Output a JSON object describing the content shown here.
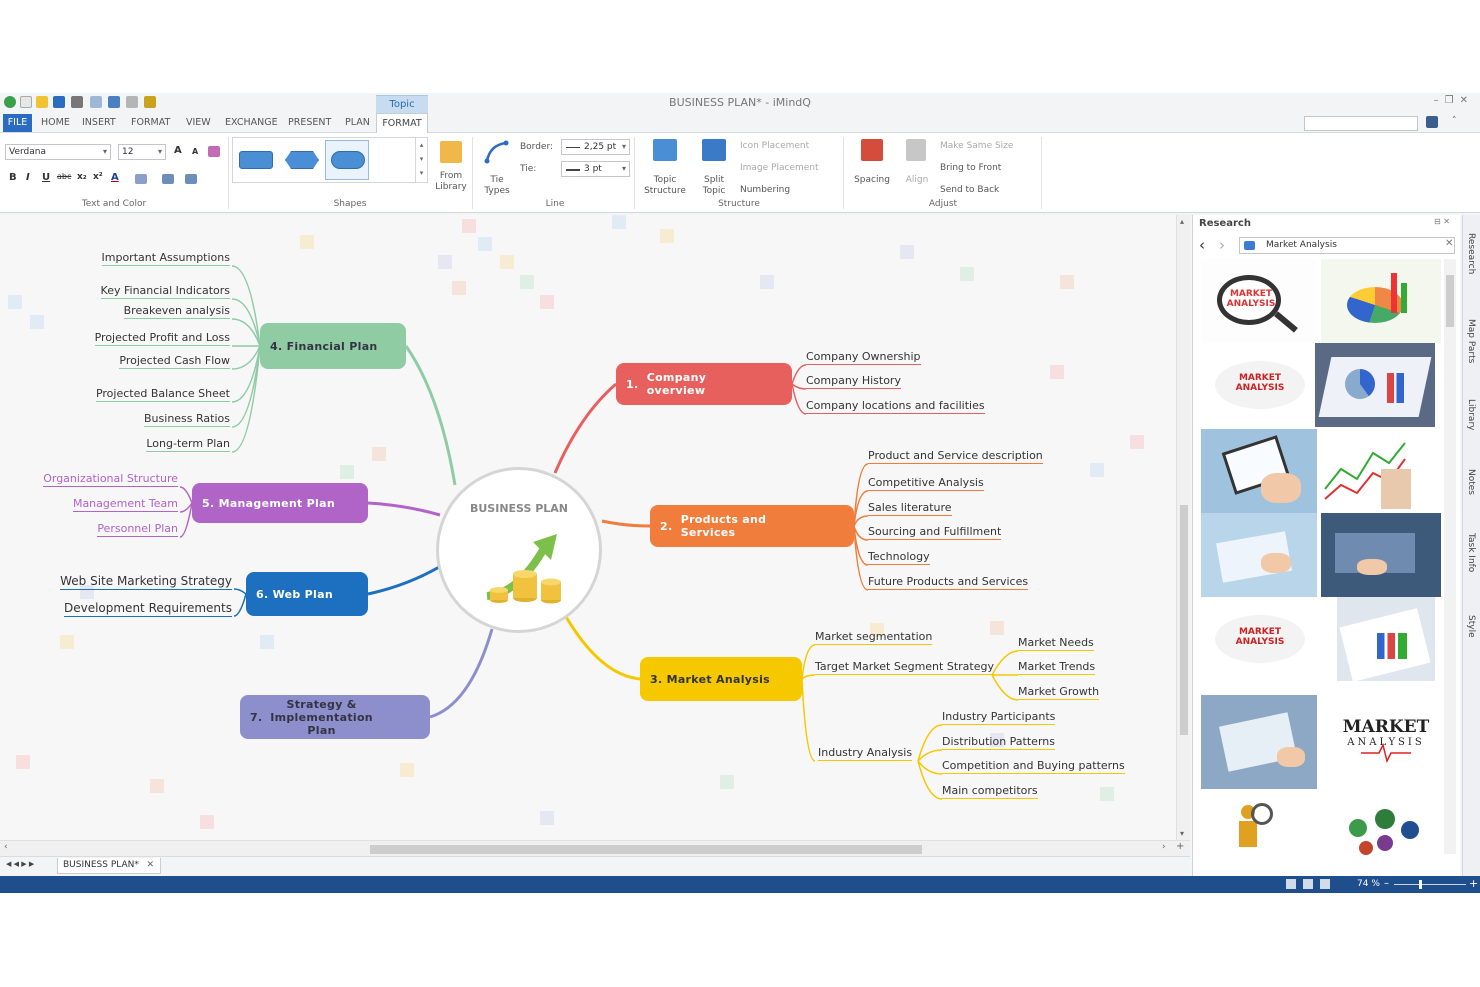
{
  "window": {
    "title": "BUSINESS PLAN* - iMindQ",
    "context_tab": "Topic",
    "min_btn": "–",
    "restore_btn": "❐",
    "close_btn": "✕"
  },
  "menu": {
    "file": "FILE",
    "items": [
      "HOME",
      "INSERT",
      "FORMAT",
      "VIEW",
      "EXCHANGE",
      "PRESENT",
      "PLAN"
    ],
    "active": "FORMAT"
  },
  "ribbon": {
    "font_name": "Verdana",
    "font_size": "12",
    "format_buttons": [
      "B",
      "I",
      "U",
      "abc",
      "x₂",
      "x²",
      "A"
    ],
    "group_text_color": "Text and Color",
    "group_shapes": "Shapes",
    "from_library": "From Library",
    "tie_types": "Tie Types",
    "border_label": "Border:",
    "border_value": "2,25 pt",
    "tie_label": "Tie:",
    "tie_value": "3 pt",
    "group_line": "Line",
    "topic_structure": "Topic Structure",
    "split_topic": "Split Topic",
    "icon_placement": "Icon Placement",
    "image_placement": "Image Placement",
    "numbering": "Numbering",
    "group_structure": "Structure",
    "spacing": "Spacing",
    "align": "Align",
    "make_same_size": "Make Same Size",
    "bring_to_front": "Bring to Front",
    "send_to_back": "Send to Back",
    "group_adjust": "Adjust"
  },
  "mindmap": {
    "center": "BUSINESS PLAN",
    "topics": {
      "company": {
        "num": "1.",
        "label": "Company overview",
        "color": "#e8605e"
      },
      "products": {
        "num": "2.",
        "label": "Products and Services",
        "color": "#f07d3c"
      },
      "market": {
        "num": "3.",
        "label": "Market Analysis",
        "color": "#f5c800"
      },
      "financial": {
        "num": "4.",
        "label": "Financial Plan",
        "color": "#8fcca4"
      },
      "management": {
        "num": "5.",
        "label": "Management Plan",
        "color": "#b064c8"
      },
      "web": {
        "num": "6.",
        "label": "Web Plan",
        "color": "#1d6fbf"
      },
      "strategy": {
        "num": "7.",
        "label": "Strategy & Implementation Plan",
        "color": "#8d8fcc"
      }
    },
    "company_subs": [
      "Company Ownership",
      "Company History",
      "Company locations and facilities"
    ],
    "products_subs": [
      "Product and Service description",
      "Competitive Analysis",
      "Sales literature",
      "Sourcing and Fulfillment",
      "Technology",
      "Future Products and Services"
    ],
    "market_subs": [
      "Market segmentation",
      "Target Market Segment Strategy",
      "Industry Analysis"
    ],
    "target_subs": [
      "Market Needs",
      "Market Trends",
      "Market Growth"
    ],
    "industry_subs": [
      "Industry Participants",
      "Distribution Patterns",
      "Competition and Buying patterns",
      "Main competitors"
    ],
    "financial_subs": [
      "Important Assumptions",
      "Key Financial Indicators",
      "Breakeven analysis",
      "Projected Profit and Loss",
      "Projected Cash Flow",
      "Projected Balance Sheet",
      "Business Ratios",
      "Long-term Plan"
    ],
    "management_subs": [
      "Organizational Structure",
      "Management Team",
      "Personnel Plan"
    ],
    "web_subs": [
      "Web Site Marketing Strategy",
      "Development Requirements"
    ]
  },
  "research": {
    "title": "Research",
    "query": "Market Analysis",
    "thumb_text": {
      "t0": "MARKET ANALYSIS",
      "t2": "MARKET ANALYSIS",
      "t8": "MARKET ANALYSIS",
      "t11a": "MARKET",
      "t11b": "ANALYSIS"
    }
  },
  "side_tabs": [
    "Research",
    "Map Parts",
    "Library",
    "Notes",
    "Task Info",
    "Style"
  ],
  "tabbar": {
    "doc_tab": "BUSINESS PLAN*",
    "nav": "◀ ◀ ▶ ▶"
  },
  "status": {
    "zoom": "74 %"
  }
}
